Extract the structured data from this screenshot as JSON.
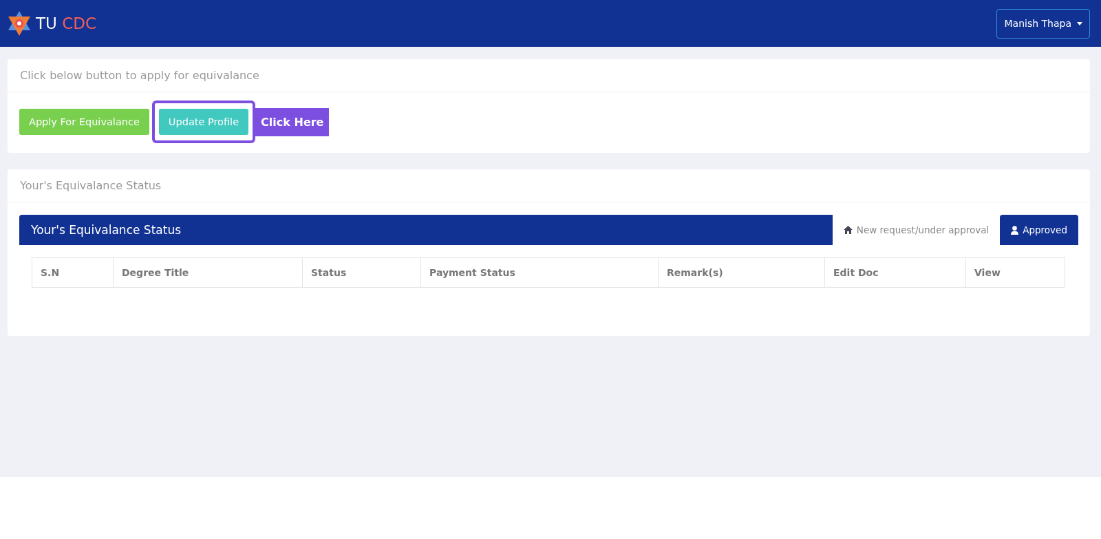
{
  "navbar": {
    "brand": {
      "first": "TU",
      "second": "CDC"
    },
    "user_menu": "Manish Thapa"
  },
  "apply_card": {
    "heading": "Click below button to apply for equivalance",
    "buttons": [
      {
        "label": "Apply For Equivalance",
        "kind": "success",
        "highlighted": false
      },
      {
        "label": "Update Profile",
        "kind": "info",
        "highlighted": true
      }
    ],
    "annotation": "Click Here"
  },
  "status_card": {
    "heading": "Your's Equivalance Status",
    "panel_title": "Your's Equivalance Status",
    "tabs": [
      {
        "label": "New request/under approval",
        "kind": "home",
        "selected": true
      },
      {
        "label": "Approved",
        "kind": "user",
        "selected": false
      }
    ],
    "table": {
      "columns": [
        "S.N",
        "Degree Title",
        "Status",
        "Payment Status",
        "Remark(s)",
        "Edit Doc",
        "View"
      ]
    }
  }
}
